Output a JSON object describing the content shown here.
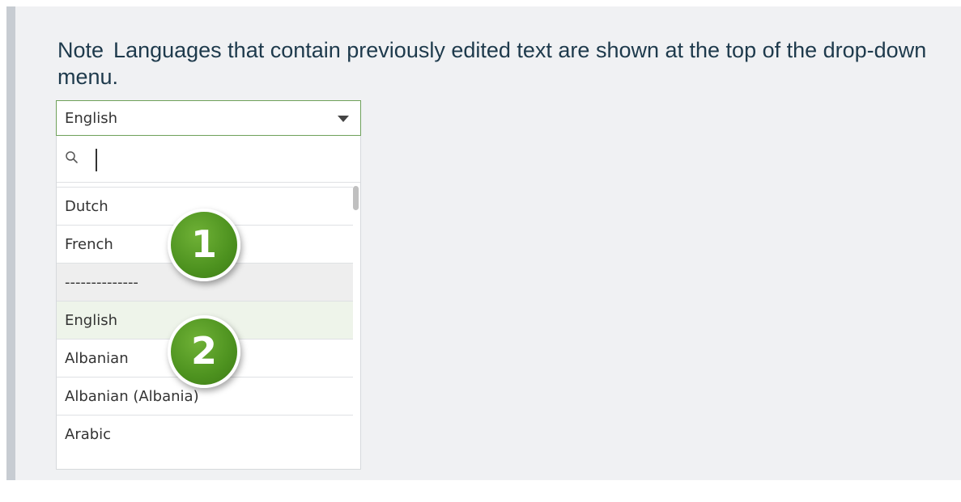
{
  "note": {
    "label": "Note",
    "text": "Languages that contain previously edited text are shown at the top of the drop-down menu."
  },
  "select": {
    "value": "English",
    "search_value": ""
  },
  "menu": {
    "items": [
      {
        "label": ""
      },
      {
        "label": "Dutch"
      },
      {
        "label": "French"
      },
      {
        "label": "--------------"
      },
      {
        "label": "English"
      },
      {
        "label": "Albanian"
      },
      {
        "label": "Albanian (Albania)"
      },
      {
        "label": "Arabic"
      }
    ]
  },
  "callouts": [
    "1",
    "2"
  ],
  "colors": {
    "note_text": "#1e3a4c",
    "badge_green": "#4d921f",
    "focus_border": "#6fa15a",
    "selected_bg": "#eef4ea"
  }
}
